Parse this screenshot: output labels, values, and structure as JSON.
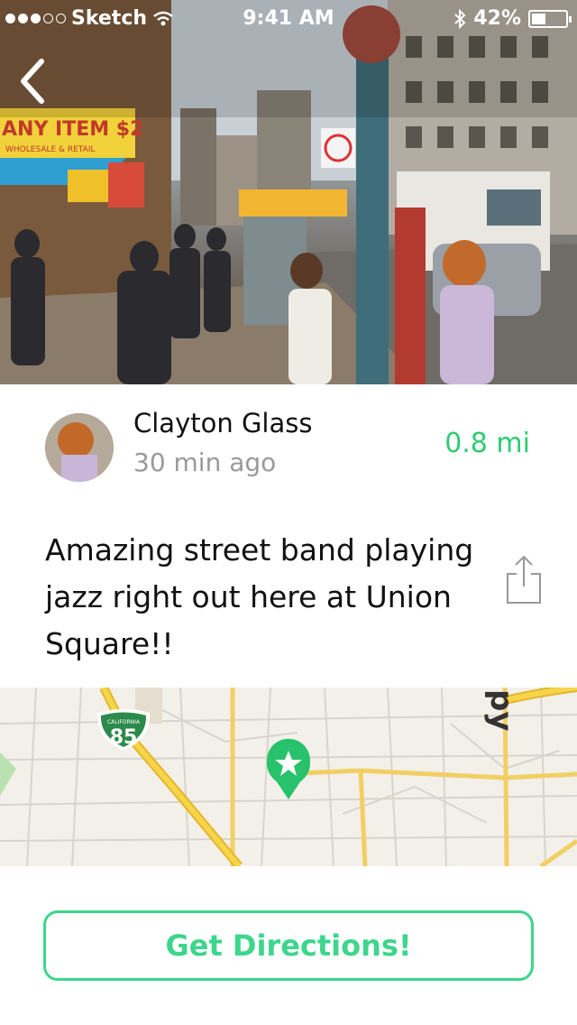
{
  "status_bar": {
    "carrier": "Sketch",
    "time": "9:41 AM",
    "battery": "42%",
    "battery_level": 0.42,
    "signal_dots_on": 3,
    "signal_dots_total": 5
  },
  "hero": {
    "photo_description_icon": "street-photo",
    "sign_text": "ANY ITEM $2",
    "sign_subtext": "WHOLESALE & RETAIL"
  },
  "post": {
    "user_name": "Clayton Glass",
    "time_ago": "30 min ago",
    "distance": "0.8 mi",
    "text": "Amazing street band playing jazz right out here at Union Square!!"
  },
  "map": {
    "highway_shield_top": "CALIFORNIA",
    "highway_number": "85",
    "partial_label": "py",
    "pin_icon": "star-pin-icon"
  },
  "actions": {
    "directions_label": "Get Directions!"
  },
  "colors": {
    "accent": "#2ecc71",
    "button_border": "#3dd68c",
    "pin": "#27c26b"
  }
}
